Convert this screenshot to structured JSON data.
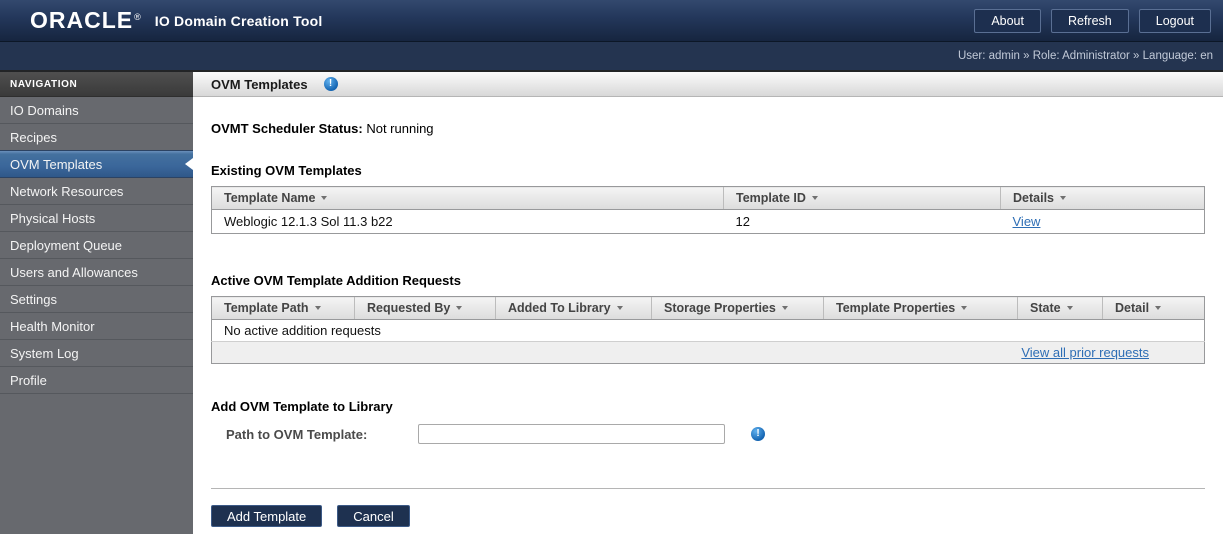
{
  "header": {
    "logo": "ORACLE",
    "logo_mark": "®",
    "title": "IO Domain Creation Tool",
    "buttons": {
      "about": "About",
      "refresh": "Refresh",
      "logout": "Logout"
    }
  },
  "user_bar": {
    "text": "User: admin » Role: Administrator » Language: en"
  },
  "sidebar": {
    "header": "NAVIGATION",
    "items": [
      {
        "label": "IO Domains"
      },
      {
        "label": "Recipes"
      },
      {
        "label": "OVM Templates",
        "active": true
      },
      {
        "label": "Network Resources"
      },
      {
        "label": "Physical Hosts"
      },
      {
        "label": "Deployment Queue"
      },
      {
        "label": "Users and Allowances"
      },
      {
        "label": "Settings"
      },
      {
        "label": "Health Monitor"
      },
      {
        "label": "System Log"
      },
      {
        "label": "Profile"
      }
    ]
  },
  "main": {
    "page_title": "OVM Templates",
    "scheduler_status_label": "OVMT Scheduler Status:",
    "scheduler_status_value": "Not running",
    "existing_templates": {
      "heading": "Existing OVM Templates",
      "columns": [
        "Template Name",
        "Template ID",
        "Details"
      ],
      "rows": [
        {
          "name": "Weblogic 12.1.3 Sol 11.3 b22",
          "id": "12",
          "details_link": "View"
        }
      ]
    },
    "addition_requests": {
      "heading": "Active OVM Template Addition Requests",
      "columns": [
        "Template Path",
        "Requested By",
        "Added To Library",
        "Storage Properties",
        "Template Properties",
        "State",
        "Detail"
      ],
      "empty_text": "No active addition requests",
      "footer_link": "View all prior requests"
    },
    "add_template": {
      "heading": "Add OVM Template to Library",
      "path_label": "Path to OVM Template:",
      "path_value": ""
    },
    "actions": {
      "add": "Add Template",
      "cancel": "Cancel"
    }
  },
  "colors": {
    "header_navy": "#16253f",
    "active_nav_blue": "#3a669a",
    "link_blue": "#2e6eb5",
    "info_icon_blue": "#1565b2",
    "button_navy": "#1e3150"
  }
}
